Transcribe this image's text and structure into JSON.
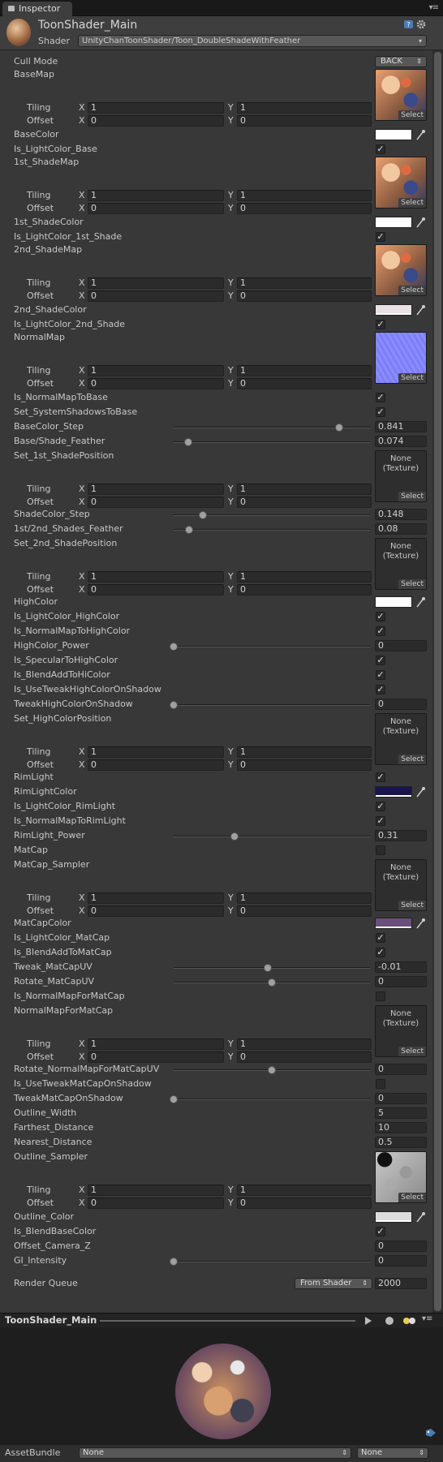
{
  "tab": {
    "label": "Inspector"
  },
  "material": {
    "name": "ToonShader_Main",
    "shader_label": "Shader",
    "shader": "UnityChanToonShader/Toon_DoubleShadeWithFeather"
  },
  "cull": {
    "label": "Cull Mode",
    "value": "BACK"
  },
  "tiling_label": "Tiling",
  "offset_label": "Offset",
  "x_label": "X",
  "y_label": "Y",
  "one": "1",
  "zero": "0",
  "select_label": "Select",
  "none_tex": "None\n(Texture)",
  "props": {
    "basemap": "BaseMap",
    "basecolor": "BaseColor",
    "is_lc_base": "Is_LightColor_Base",
    "shademap1": "1st_ShadeMap",
    "shadecolor1": "1st_ShadeColor",
    "is_lc_1st": "Is_LightColor_1st_Shade",
    "shademap2": "2nd_ShadeMap",
    "shadecolor2": "2nd_ShadeColor",
    "is_lc_2nd": "Is_LightColor_2nd_Shade",
    "normalmap": "NormalMap",
    "is_nm_base": "Is_NormalMapToBase",
    "set_sys_shadows": "Set_SystemShadowsToBase",
    "basecolor_step": "BaseColor_Step",
    "base_shade_feather": "Base/Shade_Feather",
    "set_1st_pos": "Set_1st_ShadePosition",
    "shadecolor_step": "ShadeColor_Step",
    "shades_feather": "1st/2nd_Shades_Feather",
    "set_2nd_pos": "Set_2nd_ShadePosition",
    "highcolor": "HighColor",
    "is_lc_hc": "Is_LightColor_HighColor",
    "is_nm_hc": "Is_NormalMapToHighColor",
    "hc_power": "HighColor_Power",
    "is_spec_hc": "Is_SpecularToHighColor",
    "is_blend_hc": "Is_BlendAddToHiColor",
    "is_tweak_hc": "Is_UseTweakHighColorOnShadow",
    "tweak_hc": "TweakHighColorOnShadow",
    "set_hc_pos": "Set_HighColorPosition",
    "rimlight": "RimLight",
    "rimlight_color": "RimLightColor",
    "is_lc_rim": "Is_LightColor_RimLight",
    "is_nm_rim": "Is_NormalMapToRimLight",
    "rim_power": "RimLight_Power",
    "matcap": "MatCap",
    "matcap_sampler": "MatCap_Sampler",
    "matcap_color": "MatCapColor",
    "is_lc_matcap": "Is_LightColor_MatCap",
    "is_blend_matcap": "Is_BlendAddToMatCap",
    "tweak_matcap": "Tweak_MatCapUV",
    "rotate_matcap": "Rotate_MatCapUV",
    "is_nm_matcap": "Is_NormalMapForMatCap",
    "nm_for_matcap": "NormalMapForMatCap",
    "rotate_nm_matcap": "Rotate_NormalMapForMatCapUV",
    "is_tweak_matcap": "Is_UseTweakMatCapOnShadow",
    "tweak_matcap_shadow": "TweakMatCapOnShadow",
    "outline_width": "Outline_Width",
    "farthest": "Farthest_Distance",
    "nearest": "Nearest_Distance",
    "outline_sampler": "Outline_Sampler",
    "outline_color": "Outline_Color",
    "is_blend_base": "Is_BlendBaseColor",
    "offset_cam": "Offset_Camera_Z",
    "gi": "GI_Intensity"
  },
  "values": {
    "basecolor_step": "0.841",
    "base_shade_feather": "0.074",
    "shadecolor_step": "0.148",
    "shades_feather": "0.08",
    "hc_power": "0",
    "tweak_hc": "0",
    "rim_power": "0.31",
    "tweak_matcap": "-0.01",
    "rotate_matcap": "0",
    "rotate_nm_matcap": "0",
    "tweak_matcap_shadow": "0",
    "outline_width": "5",
    "farthest": "10",
    "nearest": "0.5",
    "offset_cam": "0",
    "gi": "0"
  },
  "sliders": {
    "basecolor_step": 0.841,
    "base_shade_feather": 0.074,
    "shadecolor_step": 0.148,
    "shades_feather": 0.08,
    "hc_power": 0,
    "tweak_hc": 0,
    "rim_power": 0.31,
    "tweak_matcap": 0.48,
    "rotate_matcap": 0.5,
    "rotate_nm_matcap": 0.5,
    "tweak_matcap_shadow": 0,
    "gi": 0
  },
  "colors": {
    "basecolor": "#ffffff",
    "shadecolor1": "#ffffff",
    "shadecolor2": "#e8e0e4",
    "highcolor": "#ffffff",
    "rimlight": "#1c1450",
    "matcap": "#6a4f7c",
    "outline": "#dcdcdc",
    "accent": "#3a72b0"
  },
  "render_queue": {
    "label": "Render Queue",
    "mode": "From Shader",
    "value": "2000"
  },
  "preview": {
    "title": "ToonShader_Main"
  },
  "assetbundle": {
    "label": "AssetBundle",
    "value1": "None",
    "value2": "None"
  }
}
